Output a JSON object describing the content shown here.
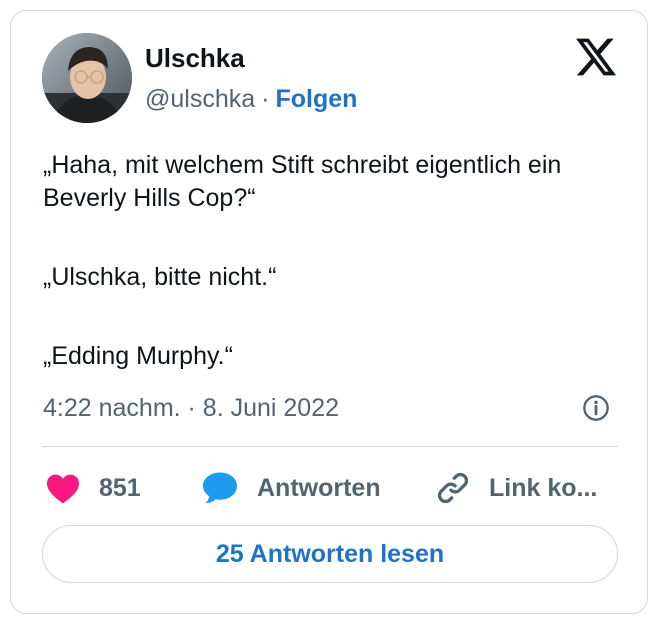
{
  "author": {
    "name": "Ulschka",
    "handle": "@ulschka",
    "separator": "·",
    "follow_label": "Folgen"
  },
  "platform_icon": "x-logo-icon",
  "tweet": {
    "lines": [
      "„Haha, mit welchem Stift schreibt eigentlich ein Beverly Hills Cop?“",
      "„Ulschka, bitte nicht.“",
      "„Edding Murphy.“"
    ],
    "timestamp": "4:22 nachm. · 8. Juni 2022"
  },
  "actions": {
    "like_count": "851",
    "reply_label": "Antworten",
    "copy_link_label": "Link ko..."
  },
  "read_replies_label": "25 Antworten lesen",
  "colors": {
    "accent_blue": "#1d73c9",
    "heart_pink": "#f91880",
    "reply_bubble_blue": "#1d9bf0",
    "secondary_text": "#536471",
    "border": "#cfd9de"
  },
  "icons": [
    "avatar",
    "x-logo-icon",
    "info-icon",
    "heart-icon",
    "reply-bubble-icon",
    "link-icon"
  ]
}
